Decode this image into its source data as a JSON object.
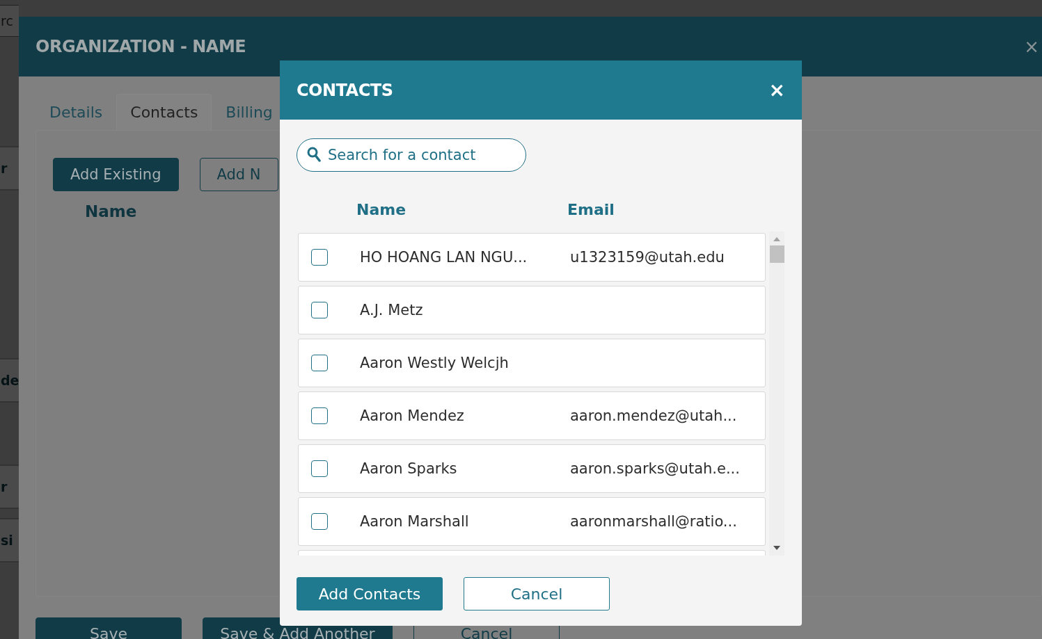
{
  "background_page": {
    "search_text": "rc",
    "row_texts": [
      "r",
      "de",
      "r",
      "si"
    ]
  },
  "organization_dialog": {
    "title": "ORGANIZATION - NAME",
    "close": "×",
    "tabs": [
      {
        "label": "Details",
        "selected": false
      },
      {
        "label": "Contacts",
        "selected": true
      },
      {
        "label": "Billing",
        "selected": false
      }
    ],
    "buttons": [
      {
        "label": "Add Existing",
        "kind": "primary"
      },
      {
        "label": "Add N",
        "kind": "outline"
      }
    ],
    "column": "Name",
    "footer_buttons": [
      {
        "label": "Save",
        "kind": "primary"
      },
      {
        "label": "Save & Add Another",
        "kind": "primary"
      },
      {
        "label": "Cancel",
        "kind": "outline"
      }
    ]
  },
  "contacts_dialog": {
    "title": "CONTACTS",
    "close": "×",
    "search": {
      "placeholder": "Search for a contact"
    },
    "columns": [
      "Name",
      "Email"
    ],
    "rows": [
      {
        "name": "HO HOANG LAN NGU...",
        "email": "u1323159@utah.edu",
        "checked": false
      },
      {
        "name": "A.J. Metz",
        "checked": false
      },
      {
        "name": "Aaron Westly Welcjh",
        "checked": false
      },
      {
        "name": "Aaron Mendez",
        "email": "aaron.mendez@utah...",
        "checked": false
      },
      {
        "name": "Aaron Sparks",
        "email": "aaron.sparks@utah.e...",
        "checked": false
      },
      {
        "name": "Aaron Marshall",
        "email": "aaronmarshall@ratio...",
        "checked": false
      }
    ],
    "buttons": [
      {
        "label": "Add Contacts",
        "kind": "primary"
      },
      {
        "label": "Cancel",
        "kind": "outline"
      }
    ]
  }
}
